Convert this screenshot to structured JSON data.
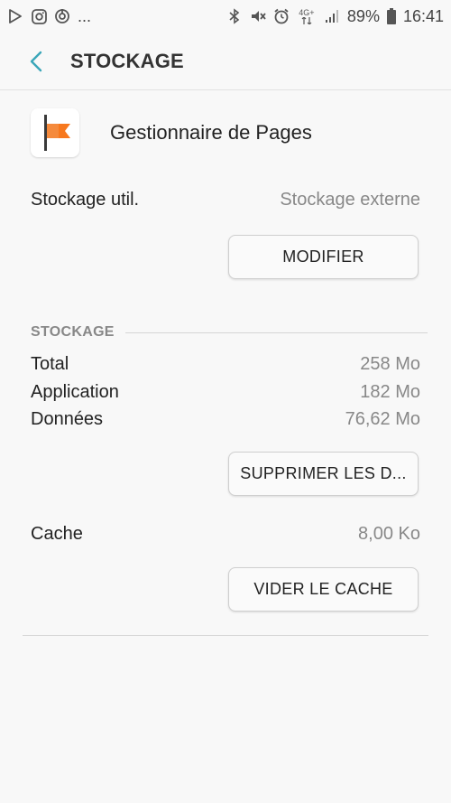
{
  "status_bar": {
    "left_icons": [
      "play-store-icon",
      "instagram-icon",
      "sync-icon"
    ],
    "more": "...",
    "battery": "89%",
    "time": "16:41",
    "network": "4G+"
  },
  "header": {
    "title": "STOCKAGE"
  },
  "app": {
    "name": "Gestionnaire de Pages",
    "icon_color": "#f7781e"
  },
  "storage_used": {
    "label": "Stockage util.",
    "value": "Stockage externe",
    "button": "MODIFIER"
  },
  "storage_section": {
    "title": "STOCKAGE",
    "rows": [
      {
        "label": "Total",
        "value": "258 Mo"
      },
      {
        "label": "Application",
        "value": "182 Mo"
      },
      {
        "label": "Données",
        "value": "76,62 Mo"
      }
    ],
    "clear_data_button": "SUPPRIMER LES D..."
  },
  "cache": {
    "label": "Cache",
    "value": "8,00 Ko",
    "button": "VIDER LE CACHE"
  },
  "colors": {
    "accent": "#3aa6b9",
    "background": "#f8f8f8"
  }
}
